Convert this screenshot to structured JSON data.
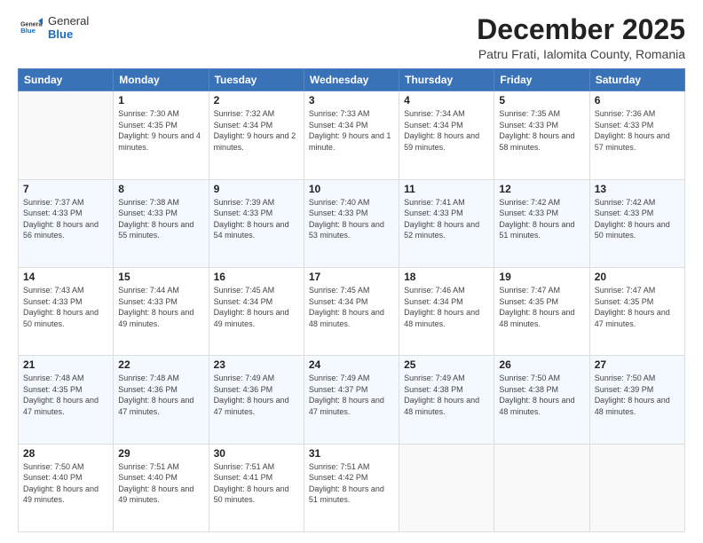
{
  "logo": {
    "general": "General",
    "blue": "Blue"
  },
  "title": "December 2025",
  "subtitle": "Patru Frati, Ialomita County, Romania",
  "days_of_week": [
    "Sunday",
    "Monday",
    "Tuesday",
    "Wednesday",
    "Thursday",
    "Friday",
    "Saturday"
  ],
  "weeks": [
    [
      {
        "day": "",
        "sunrise": "",
        "sunset": "",
        "daylight": ""
      },
      {
        "day": "1",
        "sunrise": "Sunrise: 7:30 AM",
        "sunset": "Sunset: 4:35 PM",
        "daylight": "Daylight: 9 hours and 4 minutes."
      },
      {
        "day": "2",
        "sunrise": "Sunrise: 7:32 AM",
        "sunset": "Sunset: 4:34 PM",
        "daylight": "Daylight: 9 hours and 2 minutes."
      },
      {
        "day": "3",
        "sunrise": "Sunrise: 7:33 AM",
        "sunset": "Sunset: 4:34 PM",
        "daylight": "Daylight: 9 hours and 1 minute."
      },
      {
        "day": "4",
        "sunrise": "Sunrise: 7:34 AM",
        "sunset": "Sunset: 4:34 PM",
        "daylight": "Daylight: 8 hours and 59 minutes."
      },
      {
        "day": "5",
        "sunrise": "Sunrise: 7:35 AM",
        "sunset": "Sunset: 4:33 PM",
        "daylight": "Daylight: 8 hours and 58 minutes."
      },
      {
        "day": "6",
        "sunrise": "Sunrise: 7:36 AM",
        "sunset": "Sunset: 4:33 PM",
        "daylight": "Daylight: 8 hours and 57 minutes."
      }
    ],
    [
      {
        "day": "7",
        "sunrise": "Sunrise: 7:37 AM",
        "sunset": "Sunset: 4:33 PM",
        "daylight": "Daylight: 8 hours and 56 minutes."
      },
      {
        "day": "8",
        "sunrise": "Sunrise: 7:38 AM",
        "sunset": "Sunset: 4:33 PM",
        "daylight": "Daylight: 8 hours and 55 minutes."
      },
      {
        "day": "9",
        "sunrise": "Sunrise: 7:39 AM",
        "sunset": "Sunset: 4:33 PM",
        "daylight": "Daylight: 8 hours and 54 minutes."
      },
      {
        "day": "10",
        "sunrise": "Sunrise: 7:40 AM",
        "sunset": "Sunset: 4:33 PM",
        "daylight": "Daylight: 8 hours and 53 minutes."
      },
      {
        "day": "11",
        "sunrise": "Sunrise: 7:41 AM",
        "sunset": "Sunset: 4:33 PM",
        "daylight": "Daylight: 8 hours and 52 minutes."
      },
      {
        "day": "12",
        "sunrise": "Sunrise: 7:42 AM",
        "sunset": "Sunset: 4:33 PM",
        "daylight": "Daylight: 8 hours and 51 minutes."
      },
      {
        "day": "13",
        "sunrise": "Sunrise: 7:42 AM",
        "sunset": "Sunset: 4:33 PM",
        "daylight": "Daylight: 8 hours and 50 minutes."
      }
    ],
    [
      {
        "day": "14",
        "sunrise": "Sunrise: 7:43 AM",
        "sunset": "Sunset: 4:33 PM",
        "daylight": "Daylight: 8 hours and 50 minutes."
      },
      {
        "day": "15",
        "sunrise": "Sunrise: 7:44 AM",
        "sunset": "Sunset: 4:33 PM",
        "daylight": "Daylight: 8 hours and 49 minutes."
      },
      {
        "day": "16",
        "sunrise": "Sunrise: 7:45 AM",
        "sunset": "Sunset: 4:34 PM",
        "daylight": "Daylight: 8 hours and 49 minutes."
      },
      {
        "day": "17",
        "sunrise": "Sunrise: 7:45 AM",
        "sunset": "Sunset: 4:34 PM",
        "daylight": "Daylight: 8 hours and 48 minutes."
      },
      {
        "day": "18",
        "sunrise": "Sunrise: 7:46 AM",
        "sunset": "Sunset: 4:34 PM",
        "daylight": "Daylight: 8 hours and 48 minutes."
      },
      {
        "day": "19",
        "sunrise": "Sunrise: 7:47 AM",
        "sunset": "Sunset: 4:35 PM",
        "daylight": "Daylight: 8 hours and 48 minutes."
      },
      {
        "day": "20",
        "sunrise": "Sunrise: 7:47 AM",
        "sunset": "Sunset: 4:35 PM",
        "daylight": "Daylight: 8 hours and 47 minutes."
      }
    ],
    [
      {
        "day": "21",
        "sunrise": "Sunrise: 7:48 AM",
        "sunset": "Sunset: 4:35 PM",
        "daylight": "Daylight: 8 hours and 47 minutes."
      },
      {
        "day": "22",
        "sunrise": "Sunrise: 7:48 AM",
        "sunset": "Sunset: 4:36 PM",
        "daylight": "Daylight: 8 hours and 47 minutes."
      },
      {
        "day": "23",
        "sunrise": "Sunrise: 7:49 AM",
        "sunset": "Sunset: 4:36 PM",
        "daylight": "Daylight: 8 hours and 47 minutes."
      },
      {
        "day": "24",
        "sunrise": "Sunrise: 7:49 AM",
        "sunset": "Sunset: 4:37 PM",
        "daylight": "Daylight: 8 hours and 47 minutes."
      },
      {
        "day": "25",
        "sunrise": "Sunrise: 7:49 AM",
        "sunset": "Sunset: 4:38 PM",
        "daylight": "Daylight: 8 hours and 48 minutes."
      },
      {
        "day": "26",
        "sunrise": "Sunrise: 7:50 AM",
        "sunset": "Sunset: 4:38 PM",
        "daylight": "Daylight: 8 hours and 48 minutes."
      },
      {
        "day": "27",
        "sunrise": "Sunrise: 7:50 AM",
        "sunset": "Sunset: 4:39 PM",
        "daylight": "Daylight: 8 hours and 48 minutes."
      }
    ],
    [
      {
        "day": "28",
        "sunrise": "Sunrise: 7:50 AM",
        "sunset": "Sunset: 4:40 PM",
        "daylight": "Daylight: 8 hours and 49 minutes."
      },
      {
        "day": "29",
        "sunrise": "Sunrise: 7:51 AM",
        "sunset": "Sunset: 4:40 PM",
        "daylight": "Daylight: 8 hours and 49 minutes."
      },
      {
        "day": "30",
        "sunrise": "Sunrise: 7:51 AM",
        "sunset": "Sunset: 4:41 PM",
        "daylight": "Daylight: 8 hours and 50 minutes."
      },
      {
        "day": "31",
        "sunrise": "Sunrise: 7:51 AM",
        "sunset": "Sunset: 4:42 PM",
        "daylight": "Daylight: 8 hours and 51 minutes."
      },
      {
        "day": "",
        "sunrise": "",
        "sunset": "",
        "daylight": ""
      },
      {
        "day": "",
        "sunrise": "",
        "sunset": "",
        "daylight": ""
      },
      {
        "day": "",
        "sunrise": "",
        "sunset": "",
        "daylight": ""
      }
    ]
  ]
}
